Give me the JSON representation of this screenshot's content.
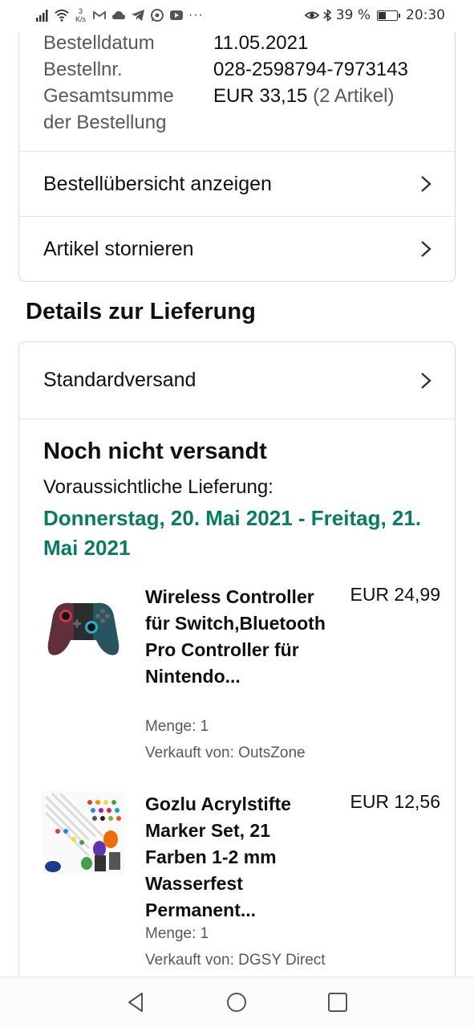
{
  "status_bar": {
    "net_speed_value": "3",
    "net_speed_unit": "K/s",
    "battery_percent": "39 %",
    "time": "20:30",
    "battery_level": 0.39
  },
  "order_info": {
    "rows": [
      {
        "label": "Bestelldatum",
        "value": "11.05.2021"
      },
      {
        "label": "Bestellnr.",
        "value": "028-2598794-7973143"
      },
      {
        "label": "Gesamtsumme der Bestellung",
        "value": "EUR 33,15",
        "value_suffix": "(2 Artikel)"
      }
    ],
    "label_line1": "Gesamtsumme",
    "label_line2": "der Bestellung",
    "links": {
      "summary": "Bestellübersicht anzeigen",
      "cancel": "Artikel stornieren"
    }
  },
  "delivery": {
    "section_title": "Details zur Lieferung",
    "shipping_method": "Standardversand",
    "status": "Noch nicht versandt",
    "eta_label": "Voraussichtliche Lieferung:",
    "eta_dates": "Donnerstag, 20. Mai 2021 - Freitag, 21. Mai 2021",
    "accent_color": "#067d62",
    "items": [
      {
        "title": "Wireless Controller für Switch,Bluetooth Pro Controller für Nintendo...",
        "price": "EUR 24,99",
        "quantity": "Menge: 1",
        "seller": "Verkauft von: OutsZone",
        "image": "game-controller"
      },
      {
        "title": "Gozlu Acrylstifte Marker Set, 21 Farben 1-2 mm Wasserfest Permanent...",
        "price": "EUR 12,56",
        "quantity": "Menge: 1",
        "seller": "Verkauft von: DGSY Direct",
        "image": "marker-set"
      }
    ]
  },
  "nav_bar": {
    "buttons": [
      "back-icon",
      "home-icon",
      "recents-icon"
    ]
  }
}
